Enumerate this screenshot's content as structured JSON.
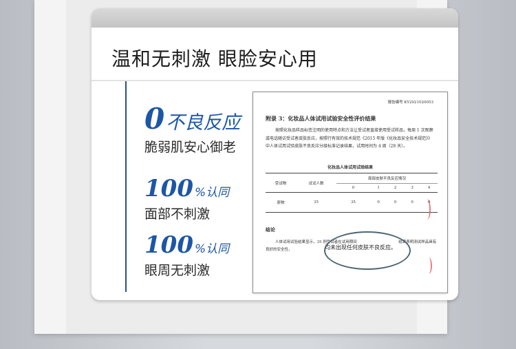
{
  "headline": "温和无刺激 眼脸安心用",
  "claims": {
    "zero": {
      "number": "0",
      "text": "不良反应",
      "sub": "脆弱肌安心御老"
    },
    "face": {
      "number": "100",
      "percent": "%",
      "approve": "认同",
      "sub": "面部不刺激"
    },
    "eye": {
      "number": "100",
      "percent": "%",
      "approve": "认同",
      "sub": "眼周无刺激"
    }
  },
  "report": {
    "report_no": "报告编号 KY2021020053",
    "appendix_title": "附录 3：化妆品人体试用试验安全性评价结果",
    "appendix_body": "按照化妆品样品标签注明的使用特点和方法让受试者直接使用受试样品，每周 1 次观察或电话随访受试者皮肤反应，按照行有效的技术规范《2015 年版《化妆品安全技术规范》》中人体试用试验皮肤不良反应分级标准记录结果，试用时间为 4 周（28 天）。",
    "table_title": "化妆品人体试用试验结果",
    "table": {
      "col_subject": "受试物",
      "col_count": "试试人数",
      "col_group": "局部皮肤不良反应情况",
      "grades": [
        "0",
        "1",
        "2",
        "3",
        "4"
      ],
      "row": {
        "subject": "原物",
        "count": "35",
        "values": [
          "35",
          "0",
          "0",
          "0",
          "0"
        ]
      }
    },
    "conclusion_title": "结论",
    "conclusion_body": "人体试用试验结果显示，35 例受试者在试用期间　　　　　　　　　　　结果表明测试样品具有良好的安全性，",
    "highlight": "均未出现任何皮肤不良反应。"
  },
  "colors": {
    "accent": "#1d56a6",
    "line": "#2a4f7e",
    "oval": "#4d6570",
    "stamp": "#e45050"
  }
}
